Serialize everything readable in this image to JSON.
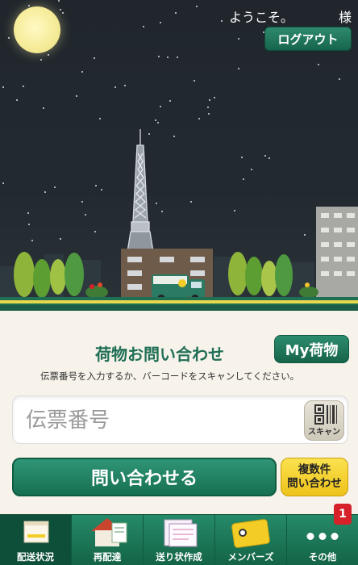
{
  "header": {
    "welcome_text": "ようこそ。　　　　様",
    "logout_label": "ログアウト"
  },
  "inquiry": {
    "title": "荷物お問い合わせ",
    "my_parcel_label": "My荷物",
    "hint": "伝票番号を入力するか、バーコードをスキャンしてください。",
    "tracking_placeholder": "伝票番号",
    "tracking_value": "",
    "scan_label": "スキャン",
    "inquire_label": "問い合わせる",
    "multi_line1": "複数件",
    "multi_line2": "問い合わせ"
  },
  "tabs": [
    {
      "label": "配送状況",
      "icon": "boxes-icon",
      "active": true
    },
    {
      "label": "再配達",
      "icon": "house-icon",
      "active": false
    },
    {
      "label": "送り状作成",
      "icon": "document-icon",
      "active": false
    },
    {
      "label": "メンバーズ",
      "icon": "member-card-icon",
      "active": false
    },
    {
      "label": "その他",
      "icon": "more-dots-icon",
      "active": false,
      "badge": "1"
    }
  ],
  "colors": {
    "brand_green": "#1f6e55",
    "accent_yellow": "#f3cd26",
    "badge_red": "#d6202a"
  }
}
